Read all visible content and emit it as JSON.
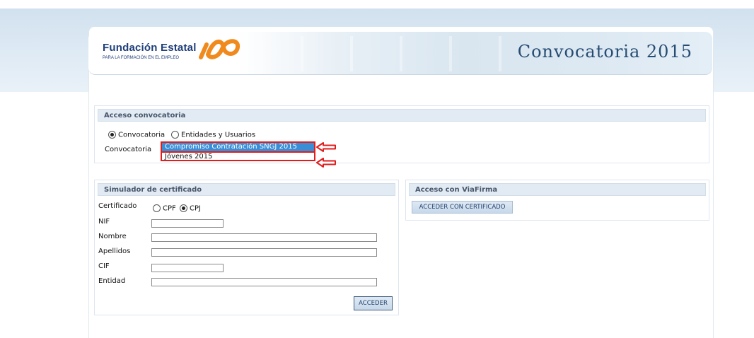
{
  "header": {
    "logo_name": "Fundación Estatal",
    "logo_subtitle": "PARA LA FORMACIÓN EN EL EMPLEO",
    "title": "Convocatoria 2015"
  },
  "acceso": {
    "title": "Acceso convocatoria",
    "radio_convocatoria": "Convocatoria",
    "radio_entidades": "Entidades y Usuarios",
    "field_label": "Convocatoria",
    "options": [
      "Compromiso Contratación SNGJ 2015",
      "Jóvenes 2015"
    ],
    "selected_index": 0
  },
  "simulador": {
    "title": "Simulador de certificado",
    "certificado_label": "Certificado",
    "cpf_label": "CPF",
    "cpj_label": "CPJ",
    "nif_label": "NIF",
    "nombre_label": "Nombre",
    "apellidos_label": "Apellidos",
    "cif_label": "CIF",
    "entidad_label": "Entidad",
    "nif_value": "",
    "nombre_value": "",
    "apellidos_value": "",
    "cif_value": "",
    "entidad_value": "",
    "button": "ACCEDER"
  },
  "viafirma": {
    "title": "Acceso con ViaFirma",
    "button": "ACCEDER CON CERTIFICADO"
  },
  "colors": {
    "accent_red": "#e01c1c",
    "selection_blue": "#3a8ed6",
    "logo_orange": "#f08a1c"
  }
}
